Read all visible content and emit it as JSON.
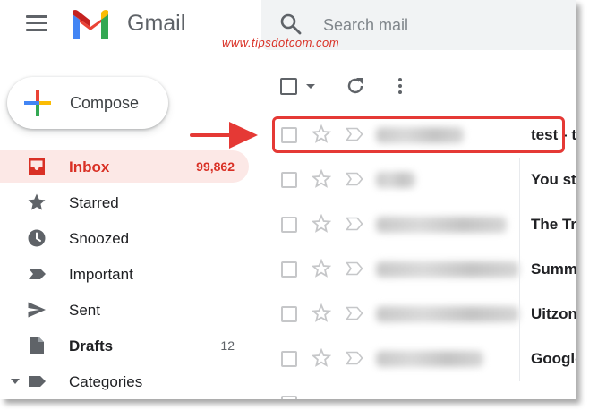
{
  "header": {
    "app_name": "Gmail",
    "search_placeholder": "Search mail",
    "watermark": "www.tipsdotcom.com"
  },
  "compose": {
    "label": "Compose"
  },
  "sidebar": {
    "items": [
      {
        "label": "Inbox",
        "count": "99,862",
        "icon": "inbox-icon",
        "active": true
      },
      {
        "label": "Starred",
        "count": "",
        "icon": "star-icon"
      },
      {
        "label": "Snoozed",
        "count": "",
        "icon": "clock-icon"
      },
      {
        "label": "Important",
        "count": "",
        "icon": "important-icon"
      },
      {
        "label": "Sent",
        "count": "",
        "icon": "send-icon"
      },
      {
        "label": "Drafts",
        "count": "12",
        "icon": "draft-icon"
      },
      {
        "label": "Categories",
        "count": "",
        "icon": "label-icon"
      }
    ]
  },
  "toolbar": {
    "select_icon": "checkbox-icon",
    "refresh_icon": "refresh-icon",
    "more_icon": "more-vert-icon"
  },
  "mail": {
    "rows": [
      {
        "subject": "test - t"
      },
      {
        "subject": "You st"
      },
      {
        "subject": "The Tr"
      },
      {
        "subject": "Summ"
      },
      {
        "subject": "Uitzon"
      },
      {
        "subject": "Google"
      }
    ]
  },
  "colors": {
    "accent": "#d93025",
    "active_bg": "#fce8e6",
    "highlight": "#e53935"
  }
}
